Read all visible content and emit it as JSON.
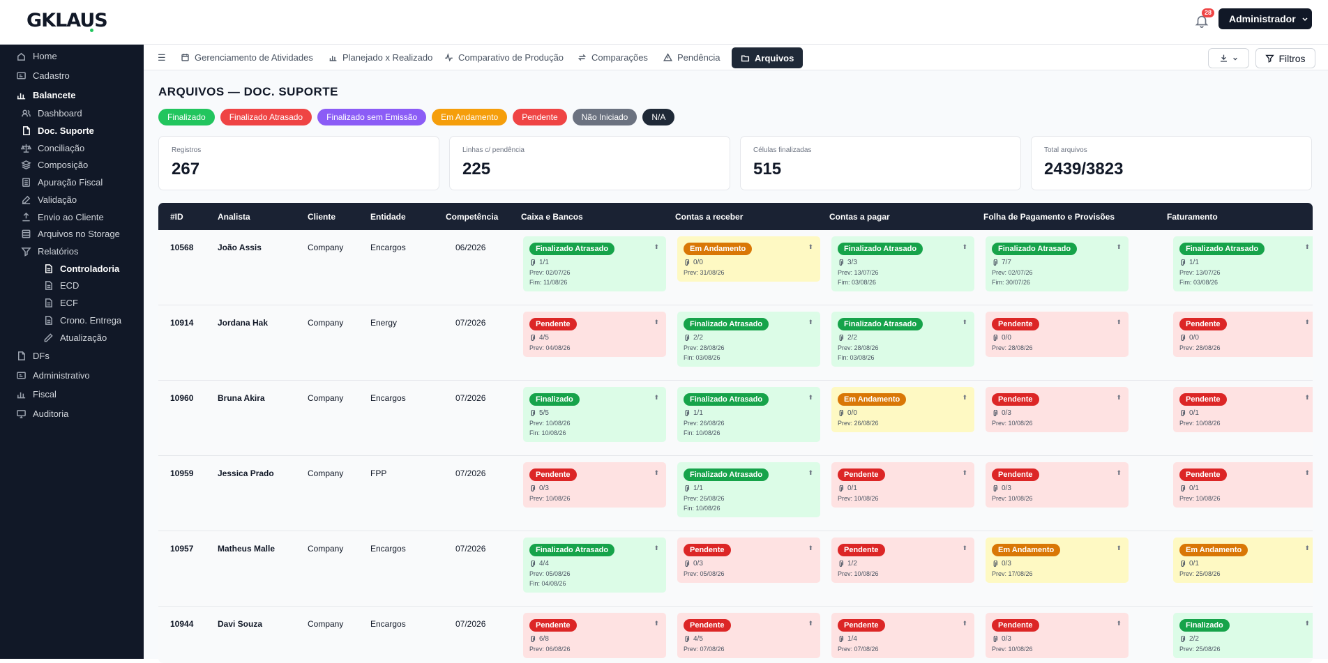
{
  "header": {
    "logo": "GKLAUS",
    "notifications_count": "28",
    "user_menu": "Administrador"
  },
  "sidebar": {
    "items": [
      {
        "label": "Home",
        "icon": "home-icon"
      },
      {
        "label": "Cadastro",
        "icon": "id-card-icon"
      },
      {
        "label": "Balancete",
        "icon": "bar-chart-icon"
      },
      {
        "label": "Dashboard",
        "icon": "users-icon"
      },
      {
        "label": "Doc. Suporte",
        "icon": "document-icon"
      },
      {
        "label": "Conciliação",
        "icon": "scale-icon"
      },
      {
        "label": "Composição",
        "icon": "layers-icon"
      },
      {
        "label": "Apuração Fiscal",
        "icon": "list-icon"
      },
      {
        "label": "Validação",
        "icon": "edit-icon"
      },
      {
        "label": "Envio ao Cliente",
        "icon": "upload-icon"
      },
      {
        "label": "Arquivos no Storage",
        "icon": "database-icon"
      },
      {
        "label": "Relatórios",
        "icon": "filter-icon"
      },
      {
        "label": "Controladoria",
        "icon": "file-icon"
      },
      {
        "label": "ECD",
        "icon": "file-icon"
      },
      {
        "label": "ECF",
        "icon": "file-icon"
      },
      {
        "label": "Crono. Entrega",
        "icon": "file-icon"
      },
      {
        "label": "Atualização",
        "icon": "pencil-icon"
      },
      {
        "label": "DFs",
        "icon": "document-icon"
      },
      {
        "label": "Administrativo",
        "icon": "id-card-icon"
      },
      {
        "label": "Fiscal",
        "icon": "bar-chart-icon"
      },
      {
        "label": "Auditoria",
        "icon": "monitor-icon"
      }
    ]
  },
  "tabs": [
    {
      "label": "Gerenciamento de Atividades",
      "icon": "calendar-icon"
    },
    {
      "label": "Planejado x Realizado",
      "icon": "bar-chart-icon"
    },
    {
      "label": "Comparativo de Produção",
      "icon": "activity-icon"
    },
    {
      "label": "Comparações",
      "icon": "swap-icon"
    },
    {
      "label": "Pendência",
      "icon": "warning-icon"
    },
    {
      "label": "Arquivos",
      "icon": "folder-icon"
    }
  ],
  "toolbar": {
    "filters_label": "Filtros"
  },
  "page": {
    "title": "ARQUIVOS — DOC. SUPORTE"
  },
  "legend": [
    {
      "label": "Finalizado",
      "color": "#22c55e"
    },
    {
      "label": "Finalizado Atrasado",
      "color": "#ef4444"
    },
    {
      "label": "Finalizado sem Emissão",
      "color": "#8b5cf6"
    },
    {
      "label": "Em Andamento",
      "color": "#f59e0b"
    },
    {
      "label": "Pendente",
      "color": "#ef4444"
    },
    {
      "label": "Não Iniciado",
      "color": "#6b7280"
    },
    {
      "label": "N/A",
      "color": "#1f2937"
    }
  ],
  "kpis": [
    {
      "label": "Registros",
      "value": "267"
    },
    {
      "label": "Linhas c/ pendência",
      "value": "225"
    },
    {
      "label": "Células finalizadas",
      "value": "515"
    },
    {
      "label": "Total arquivos",
      "value": "2439/3823"
    }
  ],
  "table": {
    "columns": [
      "#ID",
      "Analista",
      "Cliente",
      "Entidade",
      "Competência",
      "Caixa e Bancos",
      "Contas a receber",
      "Contas a pagar",
      "Folha de Pagamento e Provisões",
      "Faturamento"
    ],
    "rows": [
      {
        "id": "10568",
        "analista": "João Assis",
        "cliente": "Company",
        "entidade": "Encargos",
        "competencia": "06/2026",
        "cells": [
          {
            "status": "Finalizado Atrasado",
            "files": "1/1",
            "prev": "Prev: 02/07/26",
            "fim": "Fim: 11/08/26"
          },
          {
            "status": "Em Andamento",
            "files": "0/0",
            "prev": "Prev: 31/08/26",
            "fim": ""
          },
          {
            "status": "Finalizado Atrasado",
            "files": "3/3",
            "prev": "Prev: 13/07/26",
            "fim": "Fim: 03/08/26"
          },
          {
            "status": "Finalizado Atrasado",
            "files": "7/7",
            "prev": "Prev: 02/07/26",
            "fim": "Fim: 30/07/26"
          },
          {
            "status": "Finalizado Atrasado",
            "files": "1/1",
            "prev": "Prev: 13/07/26",
            "fim": "Fim: 03/08/26"
          }
        ]
      },
      {
        "id": "10914",
        "analista": "Jordana Hak",
        "cliente": "Company",
        "entidade": "Energy",
        "competencia": "07/2026",
        "cells": [
          {
            "status": "Pendente",
            "files": "4/5",
            "prev": "Prev: 04/08/26",
            "fim": ""
          },
          {
            "status": "Finalizado Atrasado",
            "files": "2/2",
            "prev": "Prev: 28/08/26",
            "fim": "Fin: 03/08/26"
          },
          {
            "status": "Finalizado Atrasado",
            "files": "2/2",
            "prev": "Prev: 28/08/26",
            "fim": "Fin: 03/08/26"
          },
          {
            "status": "Pendente",
            "files": "0/0",
            "prev": "Prev: 28/08/26",
            "fim": ""
          },
          {
            "status": "Pendente",
            "files": "0/0",
            "prev": "Prev: 28/08/26",
            "fim": ""
          }
        ]
      },
      {
        "id": "10960",
        "analista": "Bruna Akira",
        "cliente": "Company",
        "entidade": "Encargos",
        "competencia": "07/2026",
        "cells": [
          {
            "status": "Finalizado",
            "files": "5/5",
            "prev": "Prev: 10/08/26",
            "fim": "Fin: 10/08/26"
          },
          {
            "status": "Finalizado Atrasado",
            "files": "1/1",
            "prev": "Prev: 26/08/26",
            "fim": "Fin: 10/08/26"
          },
          {
            "status": "Em Andamento",
            "files": "0/0",
            "prev": "Prev: 26/08/26",
            "fim": ""
          },
          {
            "status": "Pendente",
            "files": "0/3",
            "prev": "Prev: 10/08/26",
            "fim": ""
          },
          {
            "status": "Pendente",
            "files": "0/1",
            "prev": "Prev: 10/08/26",
            "fim": ""
          }
        ]
      },
      {
        "id": "10959",
        "analista": "Jessica Prado",
        "cliente": "Company",
        "entidade": "FPP",
        "competencia": "07/2026",
        "cells": [
          {
            "status": "Pendente",
            "files": "0/3",
            "prev": "Prev: 10/08/26",
            "fim": ""
          },
          {
            "status": "Finalizado Atrasado",
            "files": "1/1",
            "prev": "Prev: 26/08/26",
            "fim": "Fin: 10/08/26"
          },
          {
            "status": "Pendente",
            "files": "0/1",
            "prev": "Prev: 10/08/26",
            "fim": ""
          },
          {
            "status": "Pendente",
            "files": "0/3",
            "prev": "Prev: 10/08/26",
            "fim": ""
          },
          {
            "status": "Pendente",
            "files": "0/1",
            "prev": "Prev: 10/08/26",
            "fim": ""
          }
        ]
      },
      {
        "id": "10957",
        "analista": "Matheus Malle",
        "cliente": "Company",
        "entidade": "Encargos",
        "competencia": "07/2026",
        "cells": [
          {
            "status": "Finalizado Atrasado",
            "files": "4/4",
            "prev": "Prev: 05/08/26",
            "fim": "Fin: 04/08/26"
          },
          {
            "status": "Pendente",
            "files": "0/3",
            "prev": "Prev: 05/08/26",
            "fim": ""
          },
          {
            "status": "Pendente",
            "files": "1/2",
            "prev": "Prev: 10/08/26",
            "fim": ""
          },
          {
            "status": "Em Andamento",
            "files": "0/3",
            "prev": "Prev: 17/08/26",
            "fim": ""
          },
          {
            "status": "Em Andamento",
            "files": "0/1",
            "prev": "Prev: 25/08/26",
            "fim": ""
          }
        ]
      },
      {
        "id": "10944",
        "analista": "Davi Souza",
        "cliente": "Company",
        "entidade": "Encargos",
        "competencia": "07/2026",
        "cells": [
          {
            "status": "Pendente",
            "files": "6/8",
            "prev": "Prev: 06/08/26",
            "fim": ""
          },
          {
            "status": "Pendente",
            "files": "4/5",
            "prev": "Prev: 07/08/26",
            "fim": ""
          },
          {
            "status": "Pendente",
            "files": "1/4",
            "prev": "Prev: 07/08/26",
            "fim": ""
          },
          {
            "status": "Pendente",
            "files": "0/3",
            "prev": "Prev: 10/08/26",
            "fim": ""
          },
          {
            "status": "Finalizado",
            "files": "2/2",
            "prev": "Prev: 25/08/26",
            "fim": ""
          }
        ]
      }
    ]
  }
}
